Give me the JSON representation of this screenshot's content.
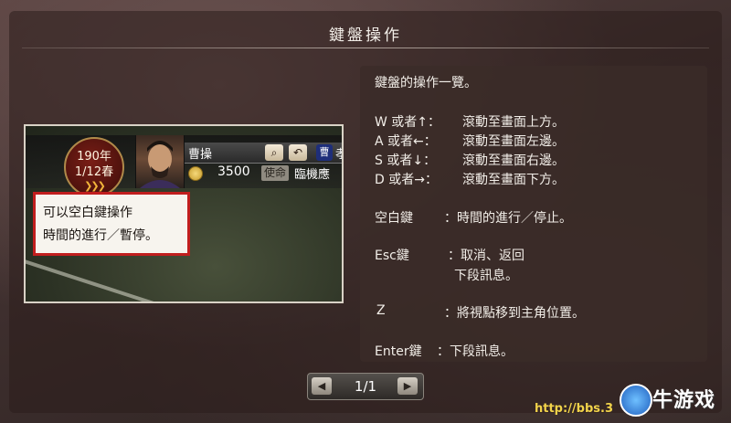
{
  "title": "鍵盤操作",
  "preview": {
    "date_year": "190年",
    "date_season": "1/12春",
    "speed_icon": "fast-forward-chevrons",
    "character_name": "曹操",
    "search_icon": "magnifier-icon",
    "back_icon": "return-arrow-icon",
    "faction_badge": "曹",
    "faction_name_partial": "孝",
    "gold": "3500",
    "mission_tag": "使命",
    "mission_text": "臨機應",
    "callout_line1": "可以空白鍵操作",
    "callout_line2": "時間的進行／暫停。",
    "callout_border_color": "#c11e1e"
  },
  "list": {
    "heading": "鍵盤的操作一覽。",
    "rows": [
      {
        "key": "W 或者↑：",
        "desc": "滾動至畫面上方。"
      },
      {
        "key": "A 或者←：",
        "desc": "滾動至畫面左邊。"
      },
      {
        "key": "S 或者↓：",
        "desc": "滾動至畫面右邊。"
      },
      {
        "key": "D 或者→：",
        "desc": "滾動至畫面下方。"
      },
      {
        "key": "空白鍵",
        "desc": "：時間的進行／停止。"
      },
      {
        "key": "Esc鍵",
        "desc": "：取消、返回"
      },
      {
        "key": "",
        "desc": "下段訊息。"
      },
      {
        "key": "Z",
        "desc": "：將視點移到主角位置。"
      },
      {
        "key": "Enter鍵",
        "desc": "：下段訊息。"
      }
    ]
  },
  "pager": {
    "label": "1/1",
    "prev_icon": "chevron-left-icon",
    "next_icon": "chevron-right-icon"
  },
  "watermark": {
    "url": "http://bbs.3",
    "logo_text": "牛游戏"
  }
}
